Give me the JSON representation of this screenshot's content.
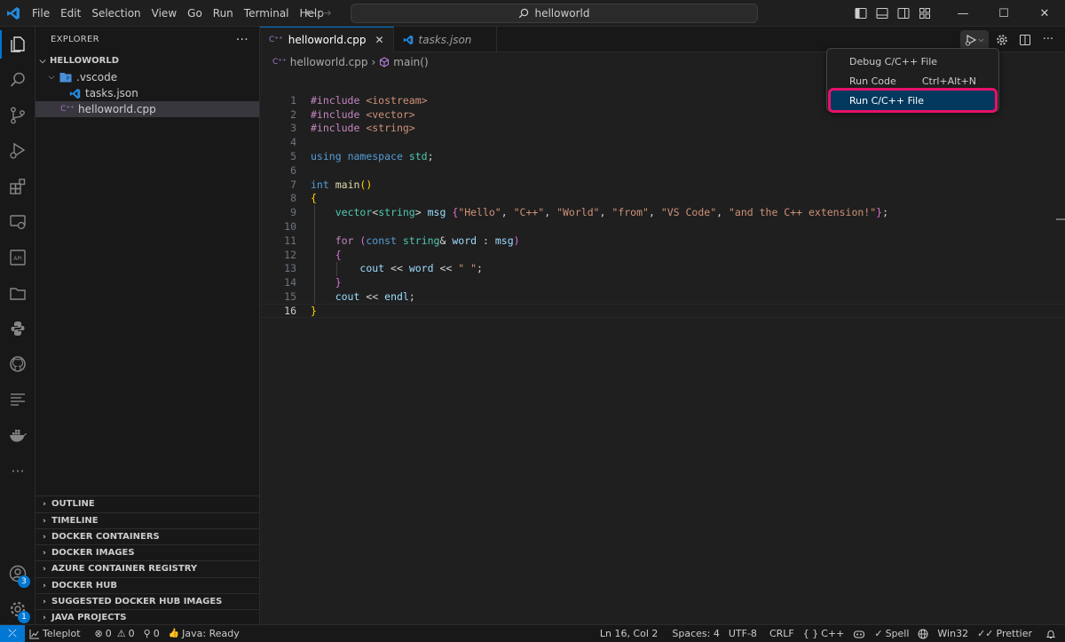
{
  "menu": [
    "File",
    "Edit",
    "Selection",
    "View",
    "Go",
    "Run",
    "Terminal",
    "Help"
  ],
  "command_center": {
    "text": "helloworld"
  },
  "window_controls": {
    "minimize": "—",
    "maximize": "☐",
    "close": "✕"
  },
  "explorer": {
    "title": "EXPLORER",
    "more": "···",
    "root": "HELLOWORLD",
    "folder": ".vscode",
    "items": [
      {
        "name": "tasks.json",
        "icon": "vscode-json-icon"
      },
      {
        "name": "helloworld.cpp",
        "icon": "cpp-file-icon"
      }
    ],
    "cpp_glyph": "C⁺⁺"
  },
  "panels": [
    "OUTLINE",
    "TIMELINE",
    "DOCKER CONTAINERS",
    "DOCKER IMAGES",
    "AZURE CONTAINER REGISTRY",
    "DOCKER HUB",
    "SUGGESTED DOCKER HUB IMAGES",
    "JAVA PROJECTS"
  ],
  "activity_badges": {
    "accounts": "3",
    "manage": "1"
  },
  "tabs": [
    {
      "label": "helloworld.cpp",
      "active": true,
      "close": "✕"
    },
    {
      "label": "tasks.json",
      "active": false
    }
  ],
  "breadcrumbs": {
    "file": "helloworld.cpp",
    "separator": "›",
    "symbol": "main()"
  },
  "code": {
    "line_numbers": [
      "1",
      "2",
      "3",
      "4",
      "5",
      "6",
      "7",
      "8",
      "9",
      "10",
      "11",
      "12",
      "13",
      "14",
      "15",
      "16"
    ],
    "current_line": 16
  },
  "run_menu": {
    "items": [
      {
        "label": "Debug C/C++ File",
        "shortcut": ""
      },
      {
        "label": "Run Code",
        "shortcut": "Ctrl+Alt+N"
      },
      {
        "label": "Run C/C++ File",
        "shortcut": ""
      }
    ],
    "highlight_color": "#e8116a"
  },
  "statusbar": {
    "remote_glyph": "⤫",
    "teleplot": "Teleplot",
    "errors": "0",
    "warnings": "0",
    "ports": "0",
    "java": "Java: Ready",
    "position": "Ln 16, Col 2",
    "spaces": "Spaces: 4",
    "encoding": "UTF-8",
    "eol": "CRLF",
    "language": "C++",
    "spell": "Spell",
    "platform": "Win32",
    "prettier": "Prettier"
  },
  "colors": {
    "accent": "#0078d4",
    "background": "#1f1f1f",
    "sidebar": "#181818"
  }
}
